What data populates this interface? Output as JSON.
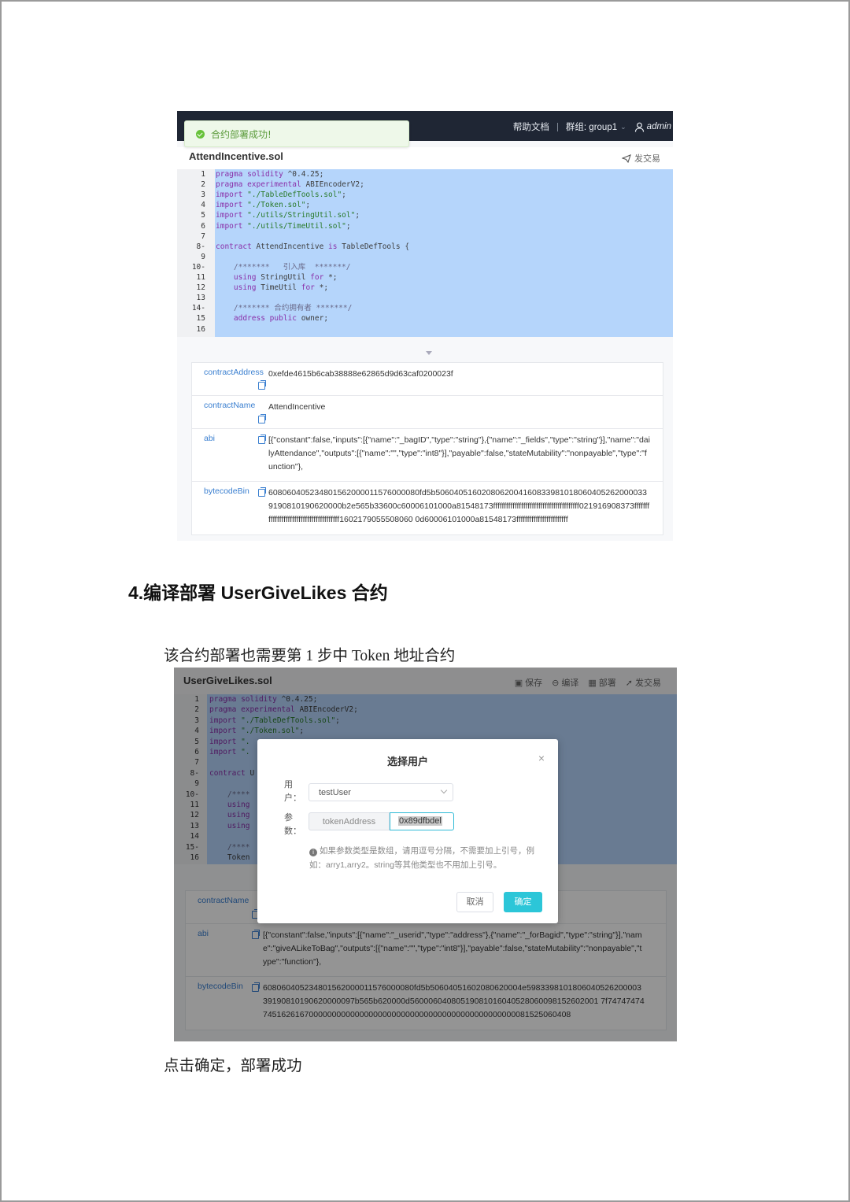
{
  "shot1": {
    "topbar": {
      "help": "帮助文档",
      "group": "群组: group1",
      "user": "admin"
    },
    "toast": "合约部署成功!",
    "file_name": "AttendIncentive.sol",
    "send_tx": "发交易",
    "code_lines": [
      {
        "n": "1",
        "text": "pragma solidity ^0.4.25;"
      },
      {
        "n": "2",
        "text": "pragma experimental ABIEncoderV2;"
      },
      {
        "n": "3",
        "text": "import \"./TableDefTools.sol\";"
      },
      {
        "n": "4",
        "text": "import \"./Token.sol\";"
      },
      {
        "n": "5",
        "text": "import \"./utils/StringUtil.sol\";"
      },
      {
        "n": "6",
        "text": "import \"./utils/TimeUtil.sol\";"
      },
      {
        "n": "7",
        "text": ""
      },
      {
        "n": "8-",
        "text": "contract AttendIncentive is TableDefTools {"
      },
      {
        "n": "9",
        "text": ""
      },
      {
        "n": "10-",
        "text": "    /*******   引入库  *******/"
      },
      {
        "n": "11",
        "text": "    using StringUtil for *;"
      },
      {
        "n": "12",
        "text": "    using TimeUtil for *;"
      },
      {
        "n": "13",
        "text": ""
      },
      {
        "n": "14-",
        "text": "    /******* 合约拥有者 *******/"
      },
      {
        "n": "15",
        "text": "    address public owner;"
      },
      {
        "n": "16",
        "text": ""
      }
    ],
    "info": {
      "address_key": "contractAddress",
      "address_val": "0xefde4615b6cab38888e62865d9d63caf0200023f",
      "name_key": "contractName",
      "name_val": "AttendIncentive",
      "abi_key": "abi",
      "abi_val": "[{\"constant\":false,\"inputs\":[{\"name\":\"_bagID\",\"type\":\"string\"},{\"name\":\"_fields\",\"type\":\"string\"}],\"name\":\"dailyAttendance\",\"outputs\":[{\"name\":\"\",\"type\":\"int8\"}],\"payable\":false,\"stateMutability\":\"nonpayable\",\"type\":\"function\"},",
      "bin_key": "bytecodeBin",
      "bin_val": "608060405234801562000011576000080fd5b50604051602080620041608339810180604052620000339190810190620000b2e565b33600c60006101000a81548173ffffffffffffffffffffffffffffffffffffffff021916908373ffffffffffffffffffffffffffffffffffffffff1602179055508060 0d60006101000a81548173ffffffffffffffffffffffff"
    }
  },
  "heading": "4.编译部署 UserGiveLikes 合约",
  "para1": "该合约部署也需要第 1 步中 Token 地址合约",
  "para2": "点击确定，部署成功",
  "shot2": {
    "file_name": "UserGiveLikes.sol",
    "tools": {
      "save": "保存",
      "compile": "编译",
      "deploy": "部署",
      "send": "发交易"
    },
    "code_lines": [
      {
        "n": "1",
        "text": "pragma solidity ^0.4.25;"
      },
      {
        "n": "2",
        "text": "pragma experimental ABIEncoderV2;"
      },
      {
        "n": "3",
        "text": "import \"./TableDefTools.sol\";"
      },
      {
        "n": "4",
        "text": "import \"./Token.sol\";"
      },
      {
        "n": "5",
        "text": "import \"."
      },
      {
        "n": "6",
        "text": "import \"."
      },
      {
        "n": "7",
        "text": ""
      },
      {
        "n": "8-",
        "text": "contract U"
      },
      {
        "n": "9",
        "text": ""
      },
      {
        "n": "10-",
        "text": "    /****"
      },
      {
        "n": "11",
        "text": "    using"
      },
      {
        "n": "12",
        "text": "    using"
      },
      {
        "n": "13",
        "text": "    using"
      },
      {
        "n": "14",
        "text": ""
      },
      {
        "n": "15-",
        "text": "    /****"
      },
      {
        "n": "16",
        "text": "    Token"
      }
    ],
    "info": {
      "name_key": "contractName",
      "abi_key": "abi",
      "abi_val": "[{\"constant\":false,\"inputs\":[{\"name\":\"_userid\",\"type\":\"address\"},{\"name\":\"_forBagid\",\"type\":\"string\"}],\"name\":\"giveALikeToBag\",\"outputs\":[{\"name\":\"\",\"type\":\"int8\"}],\"payable\":false,\"stateMutability\":\"nonpayable\",\"type\":\"function\"},",
      "bin_key": "bytecodeBin",
      "bin_val": "608060405234801562000011576000080fd5b50604051602080620004e598339810180604052620000339190810190620000097b565b620000d56000604080519081016040528060098152602001 7f747474747451626167000000000000000000000000000000000000000000000081525060408"
    },
    "dialog": {
      "title": "选择用户",
      "close": "×",
      "user_label": "用户：",
      "user_value": "testUser",
      "param_label": "参数：",
      "param_name": "tokenAddress",
      "param_value": "0x89dfbdel",
      "hint": "如果参数类型是数组，请用逗号分隔，不需要加上引号，例如：arry1,arry2。string等其他类型也不用加上引号。",
      "cancel": "取消",
      "ok": "确定"
    }
  }
}
